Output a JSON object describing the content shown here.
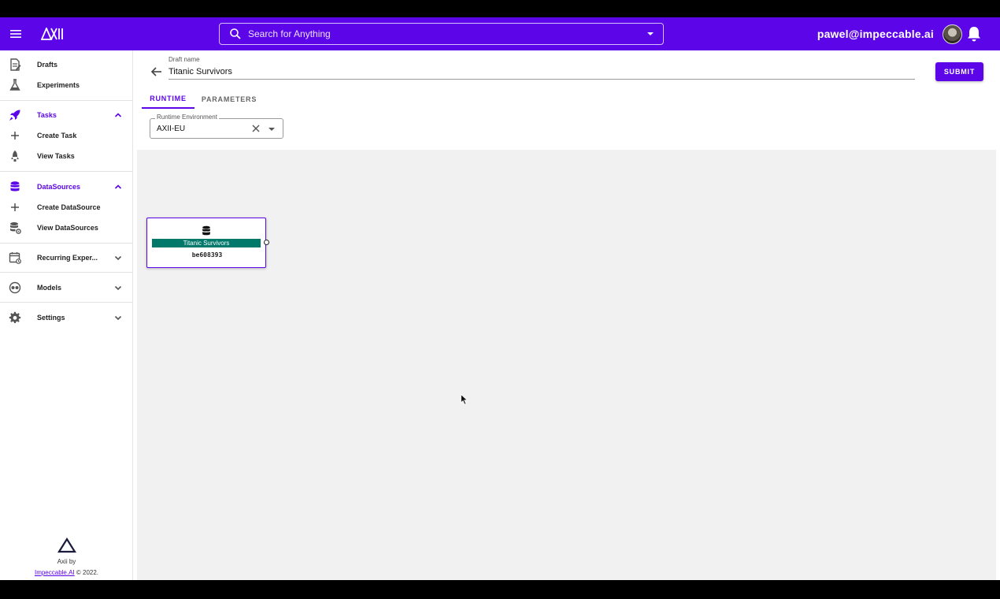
{
  "app": {
    "logo_text": "AXII",
    "accent_color": "#5b05e8"
  },
  "search": {
    "placeholder": "Search for Anything"
  },
  "user": {
    "email": "pawel@impeccable.ai"
  },
  "sidebar": {
    "items": [
      {
        "label": "Drafts",
        "icon": "drafts-icon"
      },
      {
        "label": "Experiments",
        "icon": "flask-icon"
      },
      {
        "label": "Tasks",
        "icon": "rocket-icon",
        "expanded": true
      },
      {
        "label": "Create Task",
        "icon": "plus-icon"
      },
      {
        "label": "View Tasks",
        "icon": "rocket-outline-icon"
      },
      {
        "label": "DataSources",
        "icon": "database-icon",
        "expanded": true
      },
      {
        "label": "Create DataSource",
        "icon": "plus-icon"
      },
      {
        "label": "View DataSources",
        "icon": "database-gear-icon"
      },
      {
        "label": "Recurring Exper...",
        "icon": "calendar-icon",
        "expanded": false
      },
      {
        "label": "Models",
        "icon": "models-icon",
        "expanded": false
      },
      {
        "label": "Settings",
        "icon": "gear-icon",
        "expanded": false
      }
    ],
    "footer": {
      "line1": "Axii by",
      "link": "Impeccable.AI",
      "suffix": " © 2022."
    }
  },
  "draft": {
    "label": "Draft name",
    "value": "Titanic Survivors"
  },
  "toolbar": {
    "submit_label": "SUBMIT"
  },
  "tabs": [
    {
      "label": "RUNTIME",
      "active": true
    },
    {
      "label": "PARAMETERS",
      "active": false
    }
  ],
  "runtime": {
    "label": "Runtime Environment",
    "value": "AXII-EU"
  },
  "canvas": {
    "node": {
      "title": "Titanic Survivors",
      "id": "be608393",
      "title_color": "#00796b"
    }
  }
}
